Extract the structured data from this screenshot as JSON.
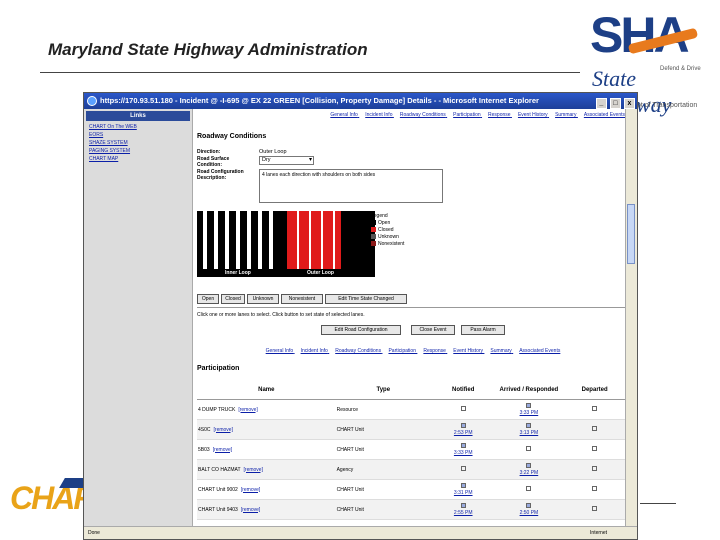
{
  "slide": {
    "title": "Maryland State Highway Administration",
    "logo_big": "SHA",
    "logo_state": "State Highway",
    "logo_tag": "Defend & Drive",
    "logo_sub": "Dept of Transportation",
    "chart_logo": "CHART"
  },
  "window": {
    "title": "https://170.93.51.180 - Incident @ -I-695 @ EX 22 GREEN [Collision, Property Damage] Details - - Microsoft Internet Explorer",
    "min": "_",
    "max": "□",
    "close": "x"
  },
  "links": {
    "header": "Links",
    "items": [
      "CHART On The WEB",
      "EORS",
      "SHAZE SYSTEM",
      "PAGING SYSTEM",
      "CHART MAP"
    ]
  },
  "nav": [
    "General Info",
    "Incident Info",
    "Roadway Conditions",
    "Participation",
    "Response",
    "Event History",
    "Summary",
    "Associated Events"
  ],
  "roadway": {
    "title": "Roadway Conditions",
    "direction_label": "Direction:",
    "direction_value": "Outer Loop",
    "surface_label": "Road Surface Condition:",
    "surface_value": "Dry",
    "config_label": "Road Configuration Description:",
    "config_value": "4 lanes each direction with shoulders on both sides",
    "inner_label": "Inner Loop",
    "outer_label": "Outer Loop"
  },
  "legend": {
    "title": "Legend",
    "items": [
      {
        "label": "Open",
        "color": "#000000"
      },
      {
        "label": "Closed",
        "color": "#e01b1b"
      },
      {
        "label": "Unknown",
        "color": "#555555"
      },
      {
        "label": "Nonexistent",
        "color": "#8b1a1a"
      }
    ]
  },
  "buttons": {
    "open": "Open",
    "closed": "Closed",
    "unknown": "Unknown",
    "nonexistent": "Nonexistent",
    "edit_lane": "Edit Time State Changed",
    "edit_road": "Edit Road Configuration",
    "close_event": "Close Event",
    "pass_alarm": "Pass Alarm"
  },
  "hint": "Click one or more lanes to select. Click button to set state of selected lanes.",
  "participation": {
    "title": "Participation",
    "headers": [
      "Name",
      "Type",
      "Notified",
      "Arrived / Responded",
      "Departed"
    ],
    "remove_label": "[remove]",
    "rows": [
      {
        "name": "4 DUMP TRUCK",
        "type": "Resource",
        "notified": "",
        "arrived": "3:33 PM",
        "departed": ""
      },
      {
        "name": "4S0C",
        "type": "CHART Unit",
        "notified": "2:53 PM",
        "arrived": "3:13 PM",
        "departed": ""
      },
      {
        "name": "5B03",
        "type": "CHART Unit",
        "notified": "3:33 PM",
        "arrived": "",
        "departed": ""
      },
      {
        "name": "BALT CO HAZMAT",
        "type": "Agency",
        "notified": "",
        "arrived": "3:22 PM",
        "departed": ""
      },
      {
        "name": "CHART Unit 9002",
        "type": "CHART Unit",
        "notified": "3:31 PM",
        "arrived": "",
        "departed": ""
      },
      {
        "name": "CHART Unit 9403",
        "type": "CHART Unit",
        "notified": "2:55 PM",
        "arrived": "2:50 PM",
        "departed": ""
      }
    ]
  },
  "status": {
    "left": "Done",
    "right": "Internet"
  }
}
